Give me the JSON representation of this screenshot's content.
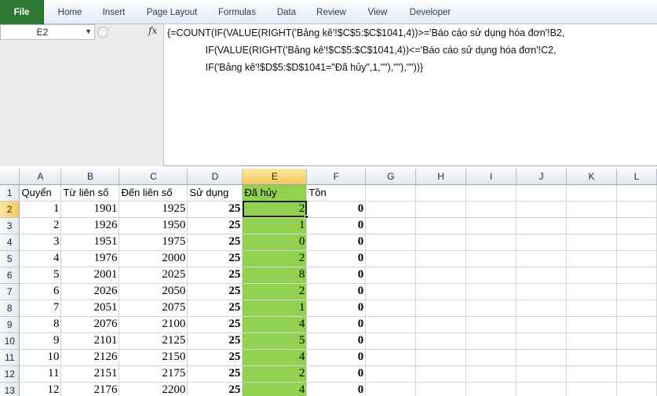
{
  "ribbon": {
    "tabs": [
      "File",
      "Home",
      "Insert",
      "Page Layout",
      "Formulas",
      "Data",
      "Review",
      "View",
      "Developer"
    ]
  },
  "formula_bar": {
    "name_box": "E2",
    "fx_label": "fx",
    "formula_lines": [
      "{=COUNT(IF(VALUE(RIGHT('Bảng kê'!$C$5:$C$1041,4))>='Báo cáo sử dụng hóa đơn'!B2,",
      "              IF(VALUE(RIGHT('Bảng kê'!$C$5:$C$1041,4))<='Báo cáo sử dụng hóa đơn'!C2,",
      "              IF('Bảng kê'!$D$5:$D$1041=\"Đã hủy\",1,\"\"),\"\"),\"\"))}"
    ]
  },
  "sheet": {
    "columns": [
      "A",
      "B",
      "C",
      "D",
      "E",
      "F",
      "G",
      "H",
      "I",
      "J",
      "K",
      "L"
    ],
    "selected_column": "E",
    "selected_row": "2",
    "header_row": [
      "Quyển",
      "Từ liên số",
      "Đến liên số",
      "Sử dụng",
      "Đã hủy",
      "Tồn"
    ],
    "rows": [
      {
        "row": "2",
        "cells": [
          "1",
          "1901",
          "1925",
          "25",
          "2",
          "0"
        ]
      },
      {
        "row": "3",
        "cells": [
          "2",
          "1926",
          "1950",
          "25",
          "1",
          "0"
        ]
      },
      {
        "row": "4",
        "cells": [
          "3",
          "1951",
          "1975",
          "25",
          "0",
          "0"
        ]
      },
      {
        "row": "5",
        "cells": [
          "4",
          "1976",
          "2000",
          "25",
          "2",
          "0"
        ]
      },
      {
        "row": "6",
        "cells": [
          "5",
          "2001",
          "2025",
          "25",
          "8",
          "0"
        ]
      },
      {
        "row": "7",
        "cells": [
          "6",
          "2026",
          "2050",
          "25",
          "2",
          "0"
        ]
      },
      {
        "row": "8",
        "cells": [
          "7",
          "2051",
          "2075",
          "25",
          "1",
          "0"
        ]
      },
      {
        "row": "9",
        "cells": [
          "8",
          "2076",
          "2100",
          "25",
          "4",
          "0"
        ]
      },
      {
        "row": "10",
        "cells": [
          "9",
          "2101",
          "2125",
          "25",
          "5",
          "0"
        ]
      },
      {
        "row": "11",
        "cells": [
          "10",
          "2126",
          "2150",
          "25",
          "4",
          "0"
        ]
      },
      {
        "row": "12",
        "cells": [
          "11",
          "2151",
          "2175",
          "25",
          "2",
          "0"
        ]
      },
      {
        "row": "13",
        "cells": [
          "12",
          "2176",
          "2200",
          "25",
          "4",
          "0"
        ]
      }
    ],
    "highlight_color": "#92d050"
  }
}
